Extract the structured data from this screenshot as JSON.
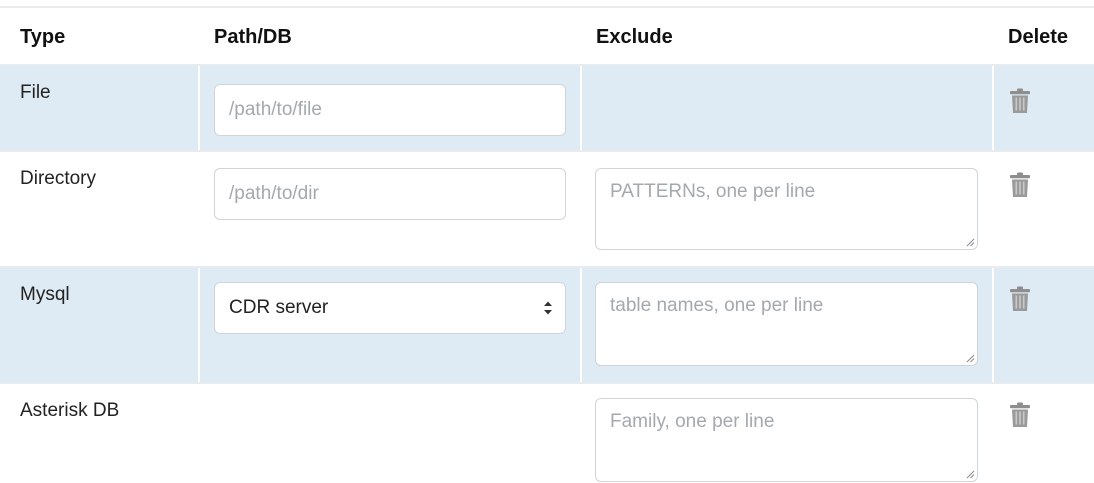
{
  "table": {
    "headers": {
      "type": "Type",
      "path": "Path/DB",
      "exclude": "Exclude",
      "delete": "Delete"
    },
    "rows": [
      {
        "type": "File",
        "path_placeholder": "/path/to/file",
        "exclude_placeholder": "",
        "shaded": true
      },
      {
        "type": "Directory",
        "path_placeholder": "/path/to/dir",
        "exclude_placeholder": "PATTERNs, one per line",
        "shaded": false
      },
      {
        "type": "Mysql",
        "path_select_value": "CDR server",
        "exclude_placeholder": "table names, one per line",
        "shaded": true
      },
      {
        "type": "Asterisk DB",
        "exclude_placeholder": "Family, one per line",
        "shaded": false
      }
    ],
    "delete_icon": "trash-icon"
  },
  "colors": {
    "row_shade": "#deebf4",
    "divider": "#e9ecee",
    "input_border": "#cfd5da",
    "placeholder_text": "#a3a9ae",
    "icon_gray": "#8e8e8e"
  }
}
